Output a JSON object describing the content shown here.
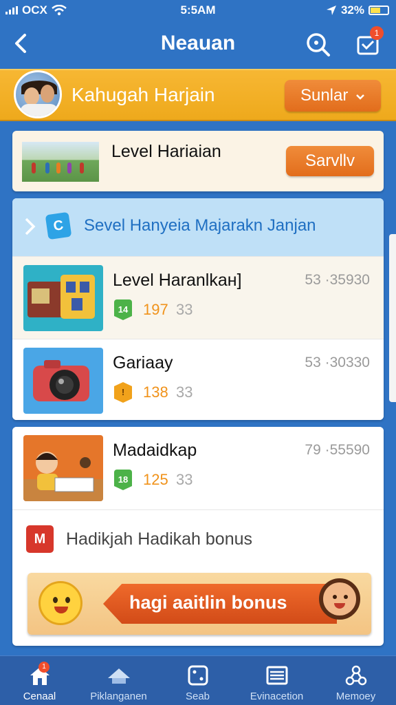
{
  "status": {
    "carrier": "OCX",
    "time": "5:5AM",
    "battery": "32%"
  },
  "header": {
    "title": "Neauan",
    "badge": "1"
  },
  "daily": {
    "label": "Kahugah Harjain",
    "button": "Sunlar"
  },
  "level": {
    "name": "Level Hariaian",
    "button": "Sarvllv"
  },
  "section": {
    "title": "Sevel Hanyeia Majarakn Janjan",
    "items": [
      {
        "name": "Level Haranlkaн]",
        "score": "53 ·35930",
        "badge": "14",
        "stat": "197",
        "stat2": "33"
      },
      {
        "name": "Gariaay",
        "score": "53 ·30330",
        "badge": "",
        "stat": "138",
        "stat2": "33"
      },
      {
        "name": "Madaidkap",
        "score": "79 ·55590",
        "badge": "18",
        "stat": "125",
        "stat2": "33"
      }
    ]
  },
  "bonus": {
    "icon": "M",
    "label": "Hadikjah Hadikah bonus",
    "banner": "hagi aaitlin bonus"
  },
  "nav": {
    "items": [
      {
        "label": "Cenaal",
        "badge": "1"
      },
      {
        "label": "Piklanganen"
      },
      {
        "label": "Seab"
      },
      {
        "label": "Evinacetion"
      },
      {
        "label": "Memoey"
      }
    ]
  },
  "colors": {
    "accent": "#2f73c4",
    "banner": "#f7b733",
    "button": "#e26d1c",
    "section_header": "#bfe0f7"
  }
}
